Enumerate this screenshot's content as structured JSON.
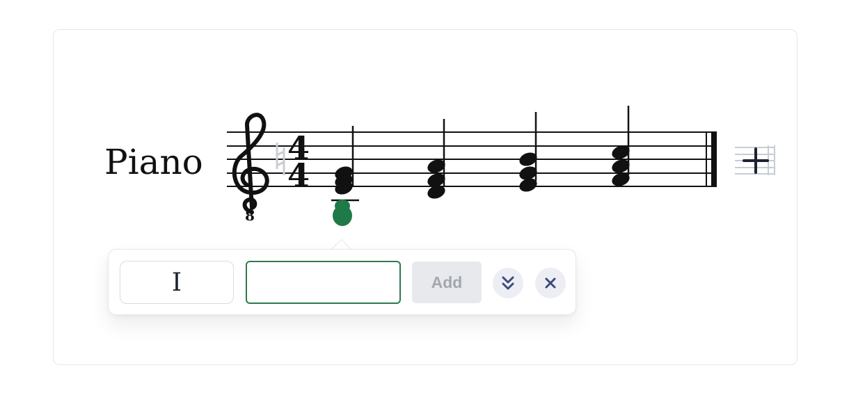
{
  "score": {
    "instrument_name": "Piano",
    "clef": "treble-8vb",
    "clef_octave_label": "8",
    "time_signature": {
      "numerator": "4",
      "denominator": "4"
    },
    "chords_in_measure": 4,
    "selected_note_color": "#1e7a46"
  },
  "popup": {
    "roman_numeral": "I",
    "chord_input_value": "",
    "add_button_label": "Add",
    "expand_icon": "double-chevron-down-icon",
    "close_icon": "close-icon"
  },
  "colors": {
    "accent": "#2d7a4a",
    "icon": "#3d4a7a"
  }
}
